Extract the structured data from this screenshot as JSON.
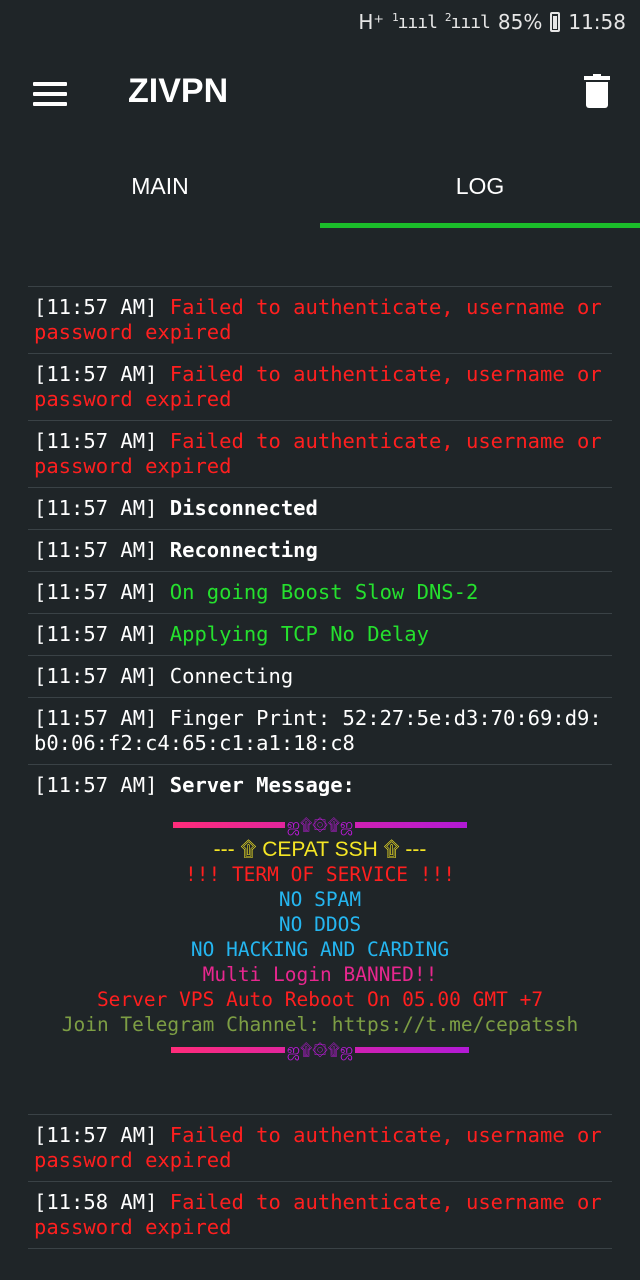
{
  "status_bar": {
    "network": "H⁺",
    "sim1": "1",
    "sim2": "2",
    "signal": "ıııl",
    "battery": "85%",
    "time": "11:58"
  },
  "app": {
    "title": "ZIVPN",
    "menu_icon": "hamburger-menu-icon",
    "clear_icon": "trash-icon"
  },
  "tabs": [
    {
      "label": "MAIN",
      "active": false
    },
    {
      "label": "LOG",
      "active": true
    }
  ],
  "colors": {
    "background": "#1f2528",
    "accent": "#1bbd2a",
    "error": "#ff1f1f",
    "success": "#25e02e"
  },
  "log": [
    {
      "time": "[11:57 AM]",
      "msg": "Failed to authenticate, username or password expired",
      "style": "red"
    },
    {
      "time": "[11:57 AM]",
      "msg": "Failed to authenticate, username or password expired",
      "style": "red"
    },
    {
      "time": "[11:57 AM]",
      "msg": "Failed to authenticate, username or password expired",
      "style": "red"
    },
    {
      "time": "[11:57 AM]",
      "msg": "Disconnected",
      "style": "boldwhite"
    },
    {
      "time": "[11:57 AM]",
      "msg": "Reconnecting",
      "style": "boldwhite"
    },
    {
      "time": "[11:57 AM]",
      "msg": "On going Boost Slow DNS-2",
      "style": "green"
    },
    {
      "time": "[11:57 AM]",
      "msg": "Applying TCP No Delay",
      "style": "green"
    },
    {
      "time": "[11:57 AM]",
      "msg": "Connecting",
      "style": "white"
    },
    {
      "time": "[11:57 AM]",
      "msg": "Finger Print: 52:27:5e:d3:70:69:d9:b0:06:f2:c4:65:c1:a1:18:c8",
      "style": "white"
    },
    {
      "time": "[11:57 AM]",
      "msg": "Server Message:",
      "style": "boldwhite"
    },
    {
      "time": "[11:57 AM]",
      "msg": "Failed to authenticate, username or password expired",
      "style": "red"
    },
    {
      "time": "[11:58 AM]",
      "msg": "Failed to authenticate, username or password expired",
      "style": "red"
    }
  ],
  "server_message": {
    "ornament": "ஜ۩۞۩ஜ",
    "title": "--- ۩ CEPAT SSH ۩ ---",
    "terms": "!!! TERM OF SERVICE !!!",
    "rule1": "NO SPAM",
    "rule2": "NO DDOS",
    "rule3": "NO HACKING AND CARDING",
    "rule4": "Multi Login BANNED!!",
    "reboot": "Server VPS Auto Reboot On 05.00 GMT +7",
    "telegram": "Join Telegram Channel: https://t.me/cepatssh"
  }
}
